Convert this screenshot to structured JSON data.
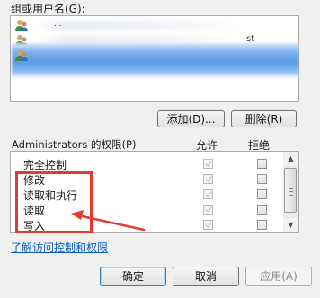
{
  "group_label": "组或用户名(G):",
  "users": [
    {
      "name": "..."
    },
    {
      "suffix": "st"
    },
    {
      "name": ""
    }
  ],
  "buttons": {
    "add": "添加(D)...",
    "remove": "删除(R)",
    "ok": "确定",
    "cancel": "取消",
    "apply": "应用(A)"
  },
  "permissions": {
    "title": "Administrators 的权限(P)",
    "allow_header": "允许",
    "deny_header": "拒绝",
    "rows": [
      {
        "label": "完全控制",
        "allow": true,
        "deny": false
      },
      {
        "label": "修改",
        "allow": true,
        "deny": false
      },
      {
        "label": "读取和执行",
        "allow": true,
        "deny": false
      },
      {
        "label": "读取",
        "allow": true,
        "deny": false
      },
      {
        "label": "写入",
        "allow": true,
        "deny": false
      }
    ]
  },
  "help_link": "了解访问控制和权限",
  "colors": {
    "annotation": "#e53a30",
    "selection": "#5a9be6",
    "link": "#0a5bc4"
  }
}
